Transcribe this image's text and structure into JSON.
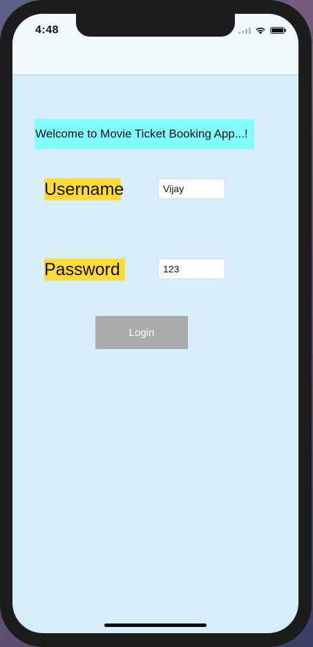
{
  "status_bar": {
    "time": "4:48",
    "icons": [
      "cellular-signal-icon",
      "wifi-icon",
      "battery-icon"
    ]
  },
  "welcome_text": "Welcome to Movie Ticket Booking App...!",
  "form": {
    "username_label": "Username",
    "username_value": "Vijay",
    "password_label": "Password",
    "password_value": "123",
    "login_label": "Login"
  },
  "colors": {
    "screen_background": "#d6edfb",
    "welcome_highlight": "#80fdfc",
    "label_highlight": "#fdd93b",
    "login_button": "#ababab"
  }
}
